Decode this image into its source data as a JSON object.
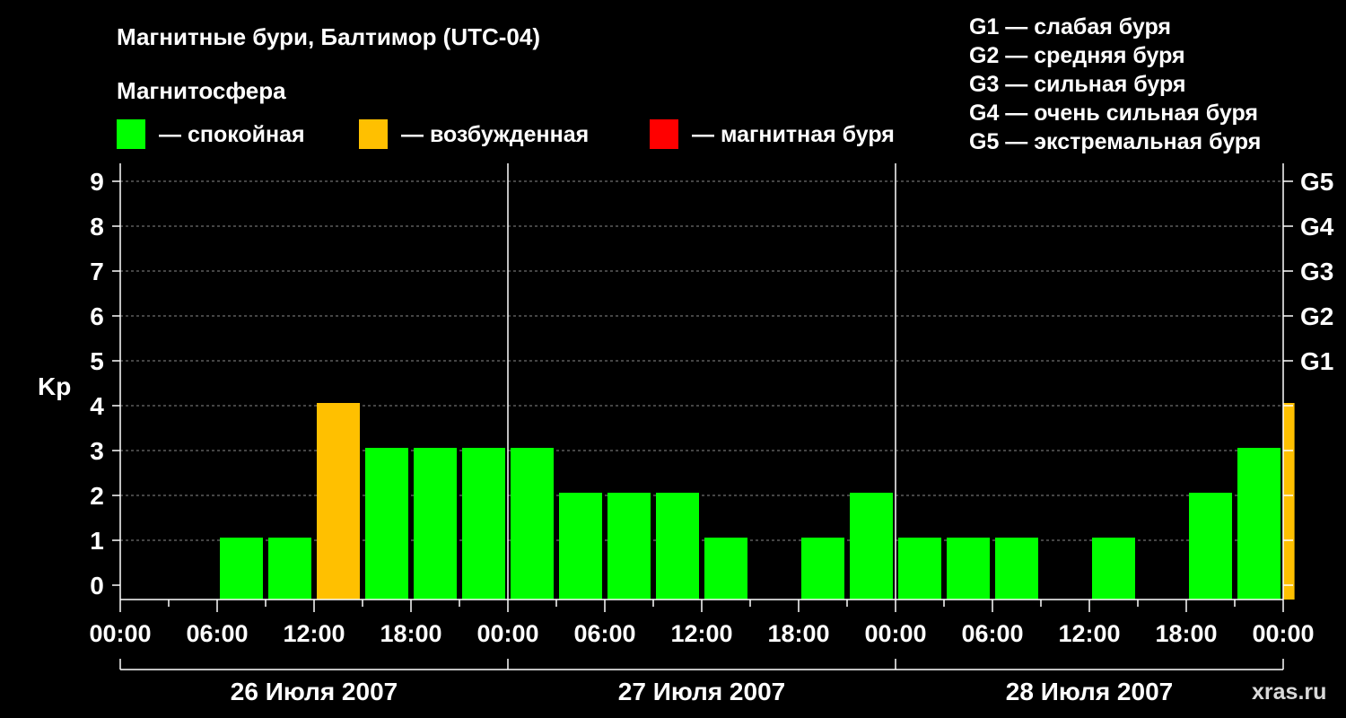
{
  "chart_data": {
    "type": "bar",
    "title": "Магнитные бури, Балтимор (UTC-04)",
    "legend": {
      "heading": "Магнитосфера",
      "items": [
        {
          "label": "— спокойная",
          "color": "#00ff00"
        },
        {
          "label": "— возбужденная",
          "color": "#ffc000"
        },
        {
          "label": "— магнитная буря",
          "color": "#ff0000"
        }
      ]
    },
    "scale_legend": [
      "G1 — слабая буря",
      "G2 — средняя буря",
      "G3 — сильная буря",
      "G4 — очень сильная буря",
      "G5 — экстремальная буря"
    ],
    "ylabel": "Kp",
    "ylim": [
      0,
      9
    ],
    "y_ticks": [
      "0",
      "1",
      "2",
      "3",
      "4",
      "5",
      "6",
      "7",
      "8",
      "9"
    ],
    "right_ticks": [
      {
        "value": 5,
        "label": "G1"
      },
      {
        "value": 6,
        "label": "G2"
      },
      {
        "value": 7,
        "label": "G3"
      },
      {
        "value": 8,
        "label": "G4"
      },
      {
        "value": 9,
        "label": "G5"
      }
    ],
    "x_tick_labels": [
      "00:00",
      "06:00",
      "12:00",
      "18:00",
      "00:00",
      "06:00",
      "12:00",
      "18:00",
      "00:00",
      "06:00",
      "12:00",
      "18:00",
      "00:00"
    ],
    "dates": [
      "26 Июля 2007",
      "27 Июля 2007",
      "28 Июля 2007"
    ],
    "grid": true,
    "bars": [
      {
        "start_hour": 0,
        "value": 0
      },
      {
        "start_hour": 3,
        "value": 0
      },
      {
        "start_hour": 6,
        "value": 1
      },
      {
        "start_hour": 9,
        "value": 1
      },
      {
        "start_hour": 12,
        "value": 4
      },
      {
        "start_hour": 15,
        "value": 3
      },
      {
        "start_hour": 18,
        "value": 3
      },
      {
        "start_hour": 21,
        "value": 3
      },
      {
        "start_hour": 24,
        "value": 3
      },
      {
        "start_hour": 27,
        "value": 2
      },
      {
        "start_hour": 30,
        "value": 2
      },
      {
        "start_hour": 33,
        "value": 2
      },
      {
        "start_hour": 36,
        "value": 1
      },
      {
        "start_hour": 39,
        "value": 0
      },
      {
        "start_hour": 42,
        "value": 1
      },
      {
        "start_hour": 45,
        "value": 2
      },
      {
        "start_hour": 48,
        "value": 1
      },
      {
        "start_hour": 51,
        "value": 1
      },
      {
        "start_hour": 54,
        "value": 1
      },
      {
        "start_hour": 57,
        "value": 0
      },
      {
        "start_hour": 60,
        "value": 1
      },
      {
        "start_hour": 63,
        "value": 0
      },
      {
        "start_hour": 66,
        "value": 2
      },
      {
        "start_hour": 69,
        "value": 3
      },
      {
        "start_hour": 72,
        "value": 4,
        "partial_hours": 0.7
      }
    ]
  },
  "watermark": "xras.ru"
}
